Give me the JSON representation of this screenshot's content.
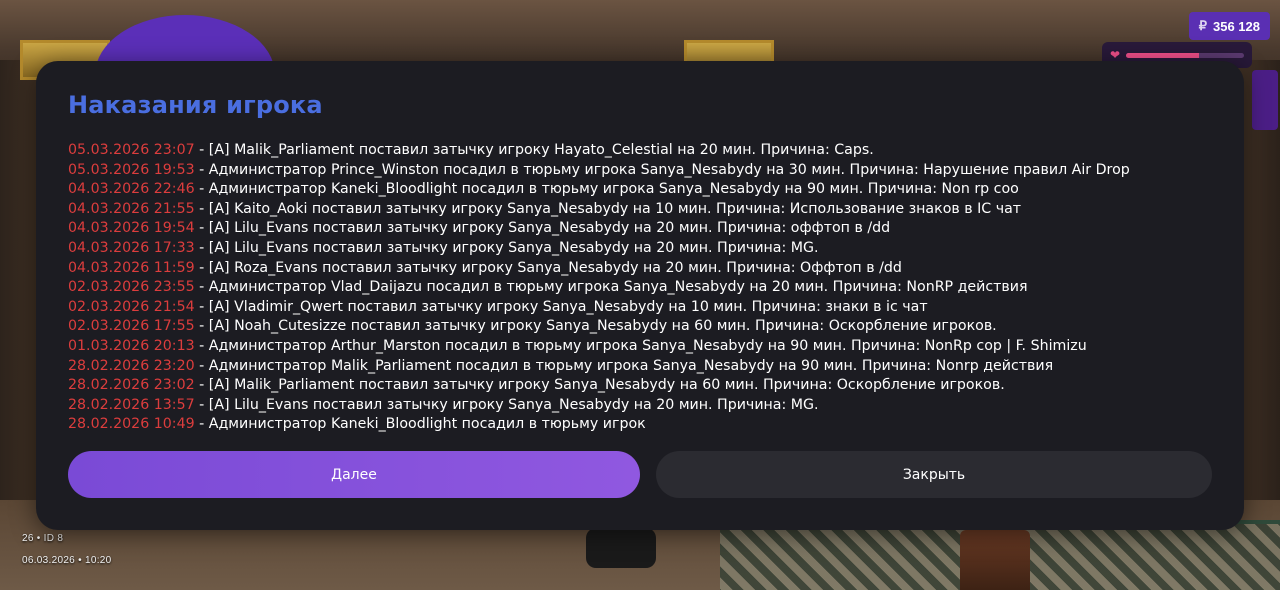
{
  "hud": {
    "currency_icon": "ruble-icon",
    "currency_symbol": "₽",
    "money": "356 128",
    "health_fraction": 0.62,
    "health_color": "#f04f8a",
    "server_line": "26 • ID 8",
    "datetime_line": "06.03.2026 • 10:20"
  },
  "dialog": {
    "title": "Наказания игрока",
    "entries": [
      {
        "time": "05.03.2026 23:07",
        "text": " - [A] Malik_Parliament поставил затычку игроку Hayato_Celestial на 20 мин. Причина: Caps."
      },
      {
        "time": "05.03.2026 19:53",
        "text": " - Администратор Prince_Winston посадил в тюрьму игрока Sanya_Nesabydy на 30 мин. Причина: Нарушение правил Air Drop"
      },
      {
        "time": "04.03.2026 22:46",
        "text": " - Администратор Kaneki_Bloodlight посадил в тюрьму игрока Sanya_Nesabydy на 90 мин. Причина: Non rp coo"
      },
      {
        "time": "04.03.2026 21:55",
        "text": " - [A] Kaito_Aoki поставил затычку игроку Sanya_Nesabydy на 10 мин. Причина: Использование знаков в IC чат"
      },
      {
        "time": "04.03.2026 19:54",
        "text": " - [A] Lilu_Evans поставил затычку игроку Sanya_Nesabydy на 20 мин. Причина: оффтоп в /dd"
      },
      {
        "time": "04.03.2026 17:33",
        "text": " - [A] Lilu_Evans поставил затычку игроку Sanya_Nesabydy на 20 мин. Причина: MG."
      },
      {
        "time": "04.03.2026 11:59",
        "text": " - [A] Roza_Evans поставил затычку игроку Sanya_Nesabydy на 20 мин. Причина: Оффтоп в /dd"
      },
      {
        "time": "02.03.2026 23:55",
        "text": " - Администратор Vlad_Daijazu посадил в тюрьму игрока Sanya_Nesabydy на 20 мин. Причина: NonRP действия"
      },
      {
        "time": "02.03.2026 21:54",
        "text": " - [A] Vladimir_Qwert поставил затычку игроку Sanya_Nesabydy на 10 мин. Причина: знаки в ic чат"
      },
      {
        "time": "02.03.2026 17:55",
        "text": " - [A] Noah_Cutesizze поставил затычку игроку Sanya_Nesabydy на 60 мин. Причина: Оскорбление игроков."
      },
      {
        "time": "01.03.2026 20:13",
        "text": " - Администратор Arthur_Marston посадил в тюрьму игрока Sanya_Nesabydy на 90 мин. Причина: NonRp cop | F. Shimizu"
      },
      {
        "time": "28.02.2026 23:20",
        "text": " - Администратор Malik_Parliament посадил в тюрьму игрока Sanya_Nesabydy на 90 мин. Причина: Nonrp действия"
      },
      {
        "time": "28.02.2026 23:02",
        "text": " - [A] Malik_Parliament поставил затычку игроку Sanya_Nesabydy на 60 мин. Причина: Оскорбление игроков."
      },
      {
        "time": "28.02.2026 13:57",
        "text": " - [A] Lilu_Evans поставил затычку игроку Sanya_Nesabydy на 20 мин. Причина: MG."
      },
      {
        "time": "28.02.2026 10:49",
        "text": " - Администратор Kaneki_Bloodlight посадил в тюрьму игрок"
      }
    ],
    "next_button": "Далее",
    "close_button": "Закрыть"
  },
  "colors": {
    "title": "#4a6ee0",
    "timestamp": "#dc3d3d",
    "dialog_bg": "#1c1c22",
    "accent_purple": "#8452dc",
    "close_button_bg": "#2b2b31"
  }
}
